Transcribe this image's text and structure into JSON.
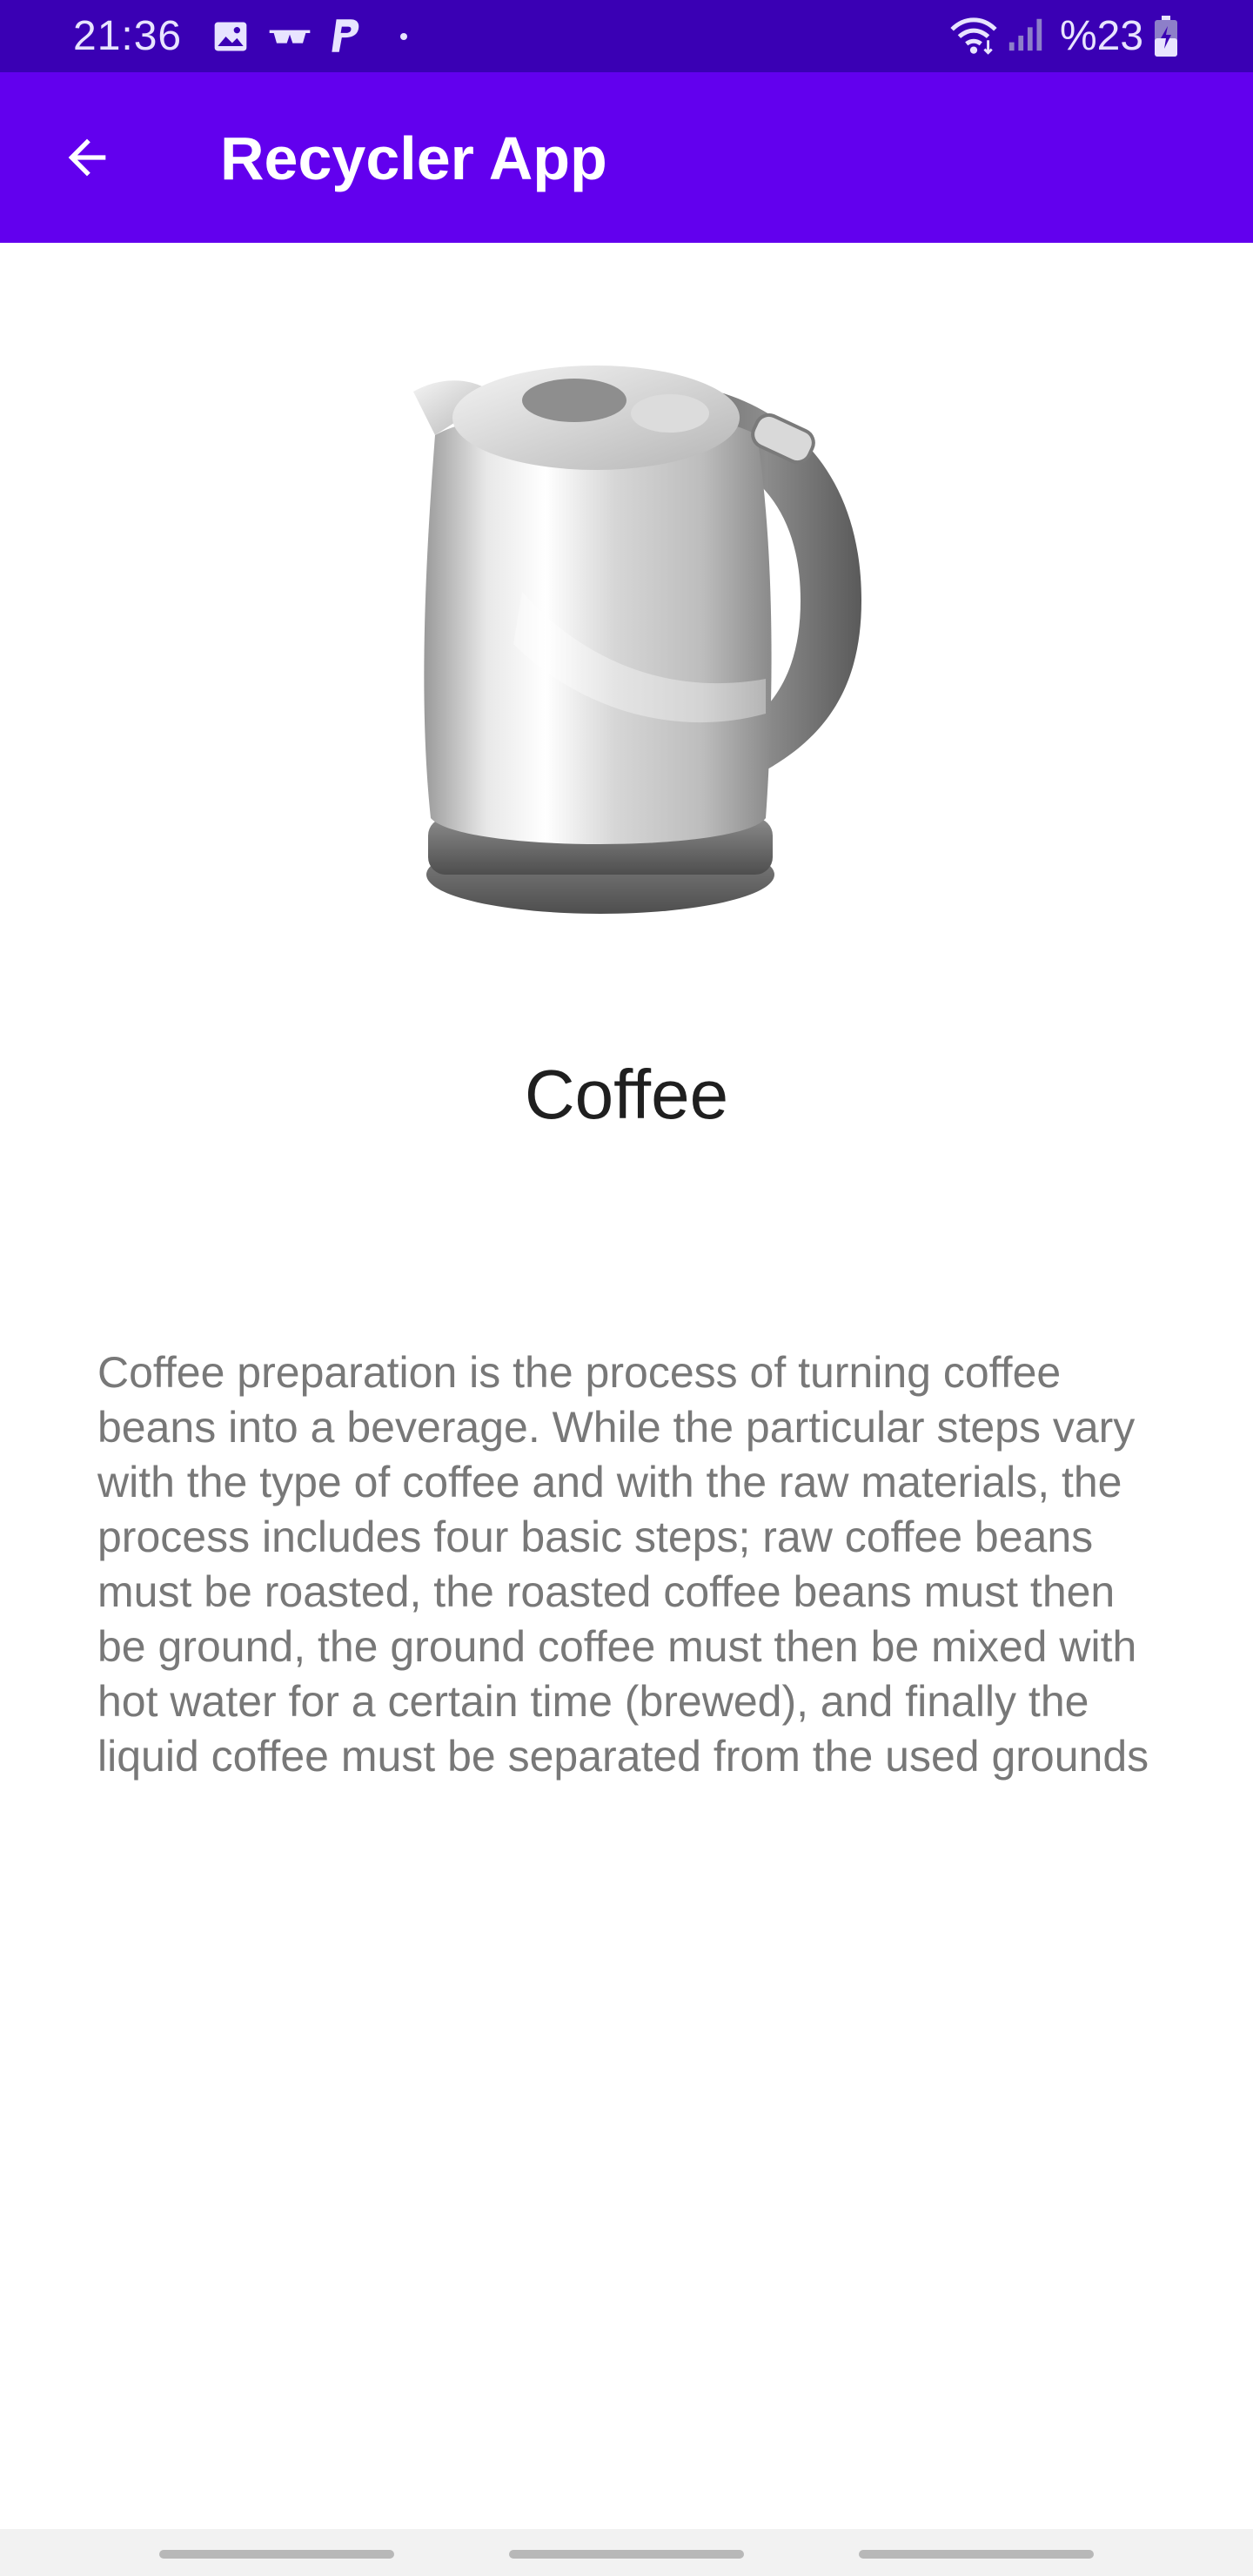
{
  "status_bar": {
    "time": "21:36",
    "battery_text": "%23",
    "icons": [
      "image-icon",
      "sunglasses-icon",
      "paypal-icon",
      "dot-icon",
      "wifi-icon",
      "signal-icon",
      "battery-charging-icon"
    ]
  },
  "app_bar": {
    "title": "Recycler App",
    "back_icon": "arrow-back-icon",
    "color": "#6200ee",
    "status_color": "#3a00b4"
  },
  "item": {
    "image": "kettle-image",
    "name": "Coffee",
    "description": "Coffee preparation is the process of turning coffee beans into a beverage. While the particular steps vary with the type of coffee and with the raw materials, the process includes four basic steps; raw coffee beans must be roasted, the roasted coffee beans must then be ground, the ground coffee must then be mixed with hot water for a certain time (brewed), and finally the liquid coffee must be separated from the used grounds"
  },
  "nav_bar": {
    "buttons": [
      "recents-button",
      "home-button",
      "back-nav-button"
    ]
  }
}
